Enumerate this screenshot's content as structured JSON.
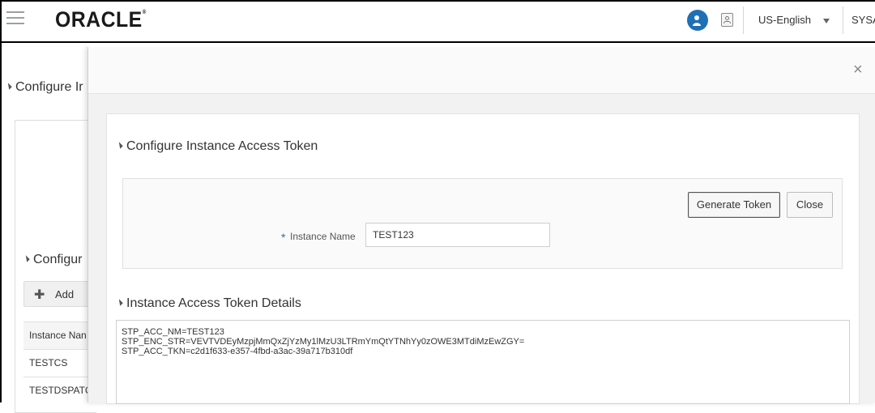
{
  "header": {
    "logo": "ORACLE",
    "language": "US-English",
    "username": "SYSA"
  },
  "background": {
    "title": "Configure Ir",
    "section_title": "Configur",
    "add_label": "Add",
    "table_header": "Instance Nan",
    "rows": [
      "TESTCS",
      "TESTDSPATCI"
    ]
  },
  "modal": {
    "section_title": "Configure Instance Access Token",
    "generate_button": "Generate Token",
    "close_button": "Close",
    "required_marker": "*",
    "instance_label": "Instance Name",
    "instance_value": "TEST123",
    "details_title": "Instance Access Token Details",
    "token_lines": [
      "STP_ACC_NM=TEST123",
      "STP_ENC_STR=VEVTVDEyMzpjMmQxZjYzMy1lMzU3LTRmYmQtYTNhYy0zOWE3MTdiMzEwZGY=",
      "STP_ACC_TKN=c2d1f633-e357-4fbd-a3ac-39a717b310df"
    ]
  },
  "colors": {
    "accent": "#1f6fb5",
    "modal_body_bg": "#f2f2f2"
  },
  "icons": {
    "menu": "hamburger-menu-icon",
    "user": "user-icon",
    "contact": "contact-card-icon",
    "close": "close-icon",
    "add": "plus-icon",
    "collapse": "collapse-triangle-icon"
  }
}
